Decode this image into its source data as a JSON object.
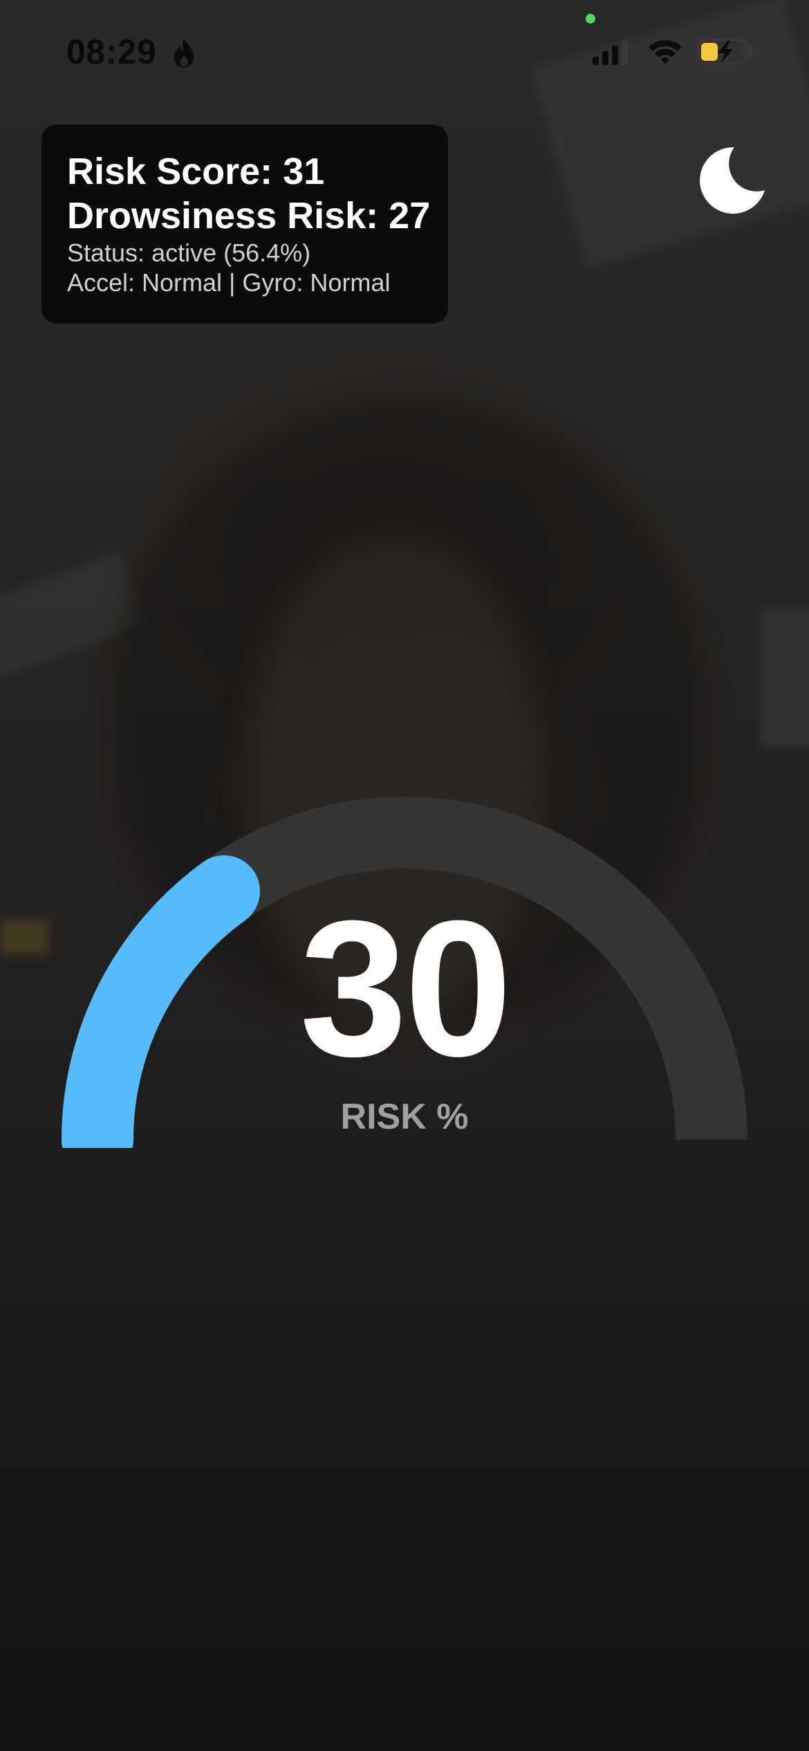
{
  "status_bar": {
    "time": "08:29",
    "icons": [
      "flame-icon",
      "signal-icon",
      "wifi-icon",
      "battery-charging-icon"
    ],
    "camera_indicator_color": "#4cd964"
  },
  "info_panel": {
    "risk_score": "Risk Score: 31",
    "drowsiness_risk": "Drowsiness Risk: 27",
    "status": "Status: active (56.4%)",
    "sensors": "Accel: Normal | Gyro: Normal"
  },
  "night_mode_button": {
    "icon": "moon-icon",
    "color": "#ffffff"
  },
  "gauge": {
    "value": "30",
    "label": "RISK %",
    "fill_fraction": 0.3,
    "fill_color": "#57bafa",
    "track_color": "#353535"
  }
}
